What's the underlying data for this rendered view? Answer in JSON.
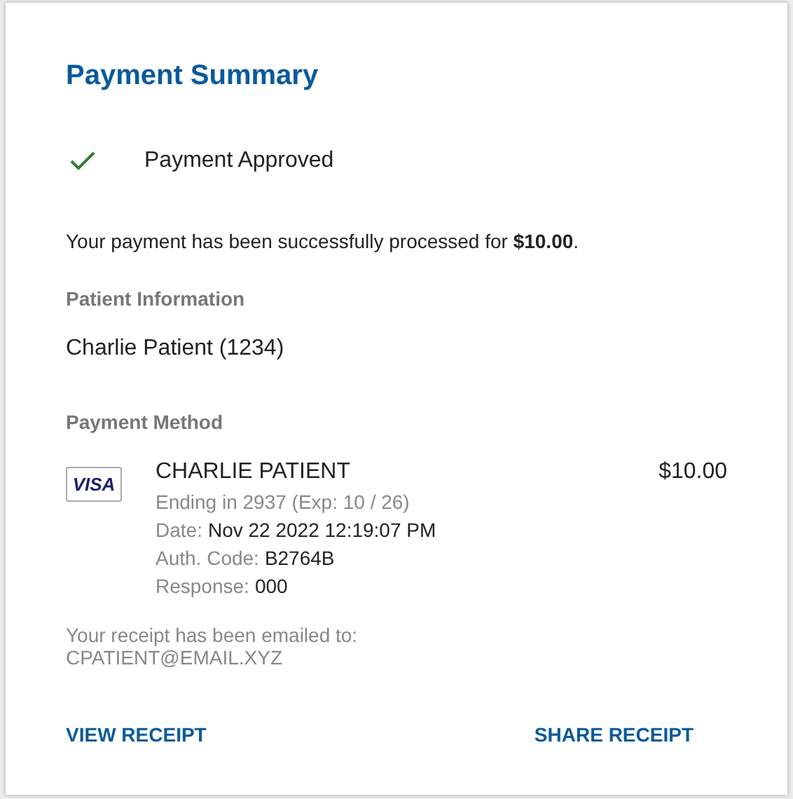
{
  "title": "Payment Summary",
  "status": {
    "label": "Payment Approved",
    "approved": true
  },
  "message": "Your payment has been successfully processed for **$10.00**.",
  "patient": {
    "heading": "Patient Information",
    "name": "Charlie Patient (1234)"
  },
  "payment_method": {
    "heading": "Payment Method",
    "card_brand": "VISA",
    "cardholder": "CHARLIE PATIENT",
    "amount": "$10.00",
    "ending": "Ending in 2937 (Exp: 10 / 26)",
    "details": [
      {
        "label": "Date:",
        "value": "Nov 22 2022 12:19:07 PM"
      },
      {
        "label": "Auth. Code:",
        "value": "B2764B"
      },
      {
        "label": "Response:",
        "value": "000"
      }
    ]
  },
  "receipt_note": [
    "Your receipt has been emailed to:",
    "CPATIENT@EMAIL.XYZ"
  ],
  "actions": [
    "VIEW RECEIPT",
    "SHARE RECEIPT"
  ]
}
